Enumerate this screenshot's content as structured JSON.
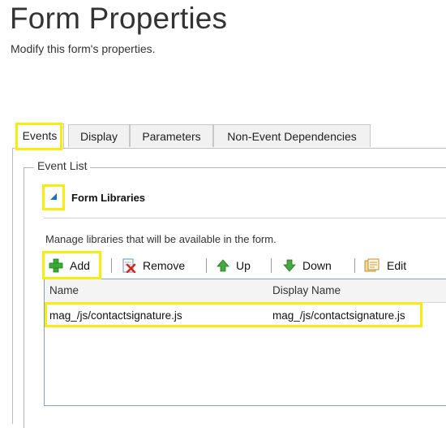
{
  "page": {
    "title": "Form Properties",
    "subtitle": "Modify this form's properties."
  },
  "tabs": [
    {
      "label": "Events",
      "active": true
    },
    {
      "label": "Display",
      "active": false
    },
    {
      "label": "Parameters",
      "active": false
    },
    {
      "label": "Non-Event Dependencies",
      "active": false
    }
  ],
  "event_list": {
    "legend": "Event List",
    "section_title": "Form Libraries",
    "section_icon": "collapse-triangle-icon",
    "description": "Manage libraries that will be available in the form."
  },
  "toolbar": {
    "add": "Add",
    "remove": "Remove",
    "up": "Up",
    "down": "Down",
    "edit": "Edit",
    "icons": [
      "plus-icon",
      "remove-icon",
      "up-arrow-icon",
      "down-arrow-icon",
      "edit-icon"
    ]
  },
  "grid": {
    "columns": [
      "Name",
      "Display Name"
    ],
    "rows": [
      {
        "name": "mag_/js/contactsignature.js",
        "display_name": "mag_/js/contactsignature.js"
      }
    ]
  },
  "colors": {
    "highlight": "#f6ec12",
    "accent_blue": "#1e6fc0",
    "add_green": "#3aa935",
    "grid_border": "#8aa0b8"
  }
}
